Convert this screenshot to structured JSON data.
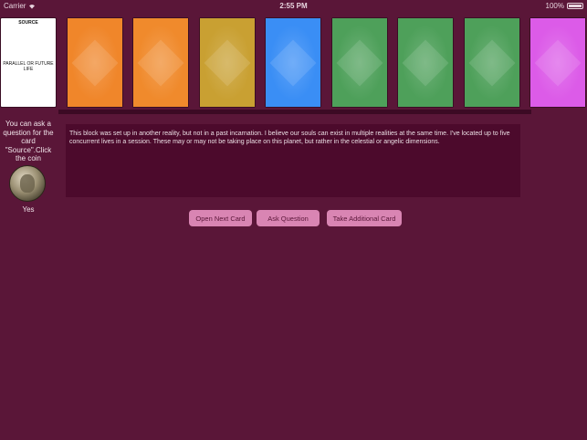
{
  "status_bar": {
    "carrier": "Carrier",
    "time": "2:55 PM",
    "battery": "100%"
  },
  "cards": {
    "source": {
      "title": "SOURCE",
      "label": "PARALLEL OR FUTURE LIFE"
    },
    "backs": [
      {
        "color": "#f0862a",
        "icon": "card-back-orange"
      },
      {
        "color": "#f08a2c",
        "icon": "card-back-orange"
      },
      {
        "color": "#c9a032",
        "icon": "card-back-gold"
      },
      {
        "color": "#3a8ef5",
        "icon": "card-back-blue"
      },
      {
        "color": "#4ea05a",
        "icon": "card-back-green"
      },
      {
        "color": "#4ea05a",
        "icon": "card-back-green"
      },
      {
        "color": "#4ea05a",
        "icon": "card-back-green"
      },
      {
        "color": "#dc5be8",
        "icon": "card-back-violet"
      }
    ]
  },
  "sidebar": {
    "prompt": "You can ask a question for the card \"Source\".Click the coin",
    "coin_icon": "coin-icon",
    "answer": "Yes"
  },
  "message": "This block was set up in another reality, but not in a past incarnation. I believe our souls can exist in multiple realities at the same time. I've located up to five concurrent lives in a session. These may or may not be taking place on this planet, but rather in the celestial or angelic dimensions.",
  "buttons": {
    "next": "Open Next Card",
    "ask": "Ask Question",
    "take": "Take Additional Card"
  },
  "colors": {
    "background": "#5a1638",
    "message_box": "#4c0a2c",
    "button": "#d985b3"
  }
}
